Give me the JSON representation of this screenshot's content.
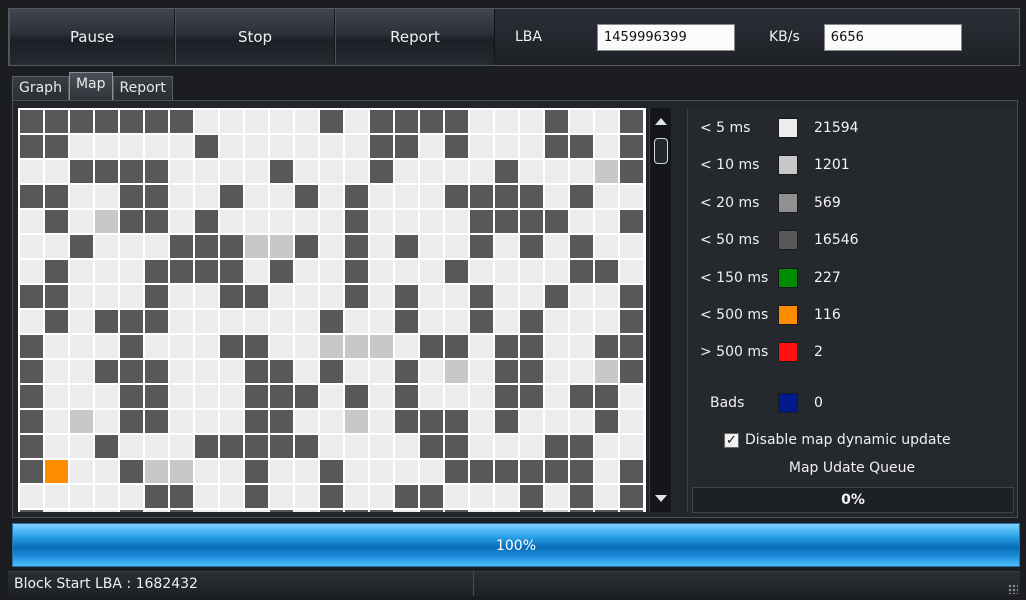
{
  "toolbar": {
    "pause_label": "Pause",
    "stop_label": "Stop",
    "report_label": "Report",
    "lba_label": "LBA",
    "lba_value": "1459996399",
    "kbs_label": "KB/s",
    "kbs_value": "6656"
  },
  "tabs": [
    {
      "label": "Graph",
      "active": false
    },
    {
      "label": "Map",
      "active": true
    },
    {
      "label": "Report",
      "active": false
    }
  ],
  "legend": {
    "items": [
      {
        "label": "< 5 ms",
        "color": "#ececec",
        "count": "21594"
      },
      {
        "label": "< 10 ms",
        "color": "#c8c8c8",
        "count": "1201"
      },
      {
        "label": "< 20 ms",
        "color": "#909090",
        "count": "569"
      },
      {
        "label": "< 50 ms",
        "color": "#585858",
        "count": "16546"
      },
      {
        "label": "< 150 ms",
        "color": "#008c00",
        "count": "227"
      },
      {
        "label": "< 500 ms",
        "color": "#ff8c00",
        "count": "116"
      },
      {
        "label": "> 500 ms",
        "color": "#ff1010",
        "count": "2"
      }
    ],
    "bads": {
      "label": "Bads",
      "color": "#001a8c",
      "count": "0"
    },
    "disable_update_label": "Disable map dynamic update",
    "disable_update_checked": true,
    "queue_label": "Map Udate Queue",
    "queue_percent": "0%"
  },
  "progress": {
    "label": "100%",
    "value": 1.0
  },
  "status": {
    "block_start": "Block Start LBA : 1682432"
  },
  "map_rows": [
    "3333333000003033330003003",
    "3300000300000033030003303",
    "0033330000300030000300013",
    "3300330030030300033330300",
    "0301330300000300003333003",
    "0030003331130303003030300",
    "0300033330300300030000330",
    "3300030033000303003003003",
    "0303330000003003003030003",
    "3000300033001110330330033",
    "3003330003303003010330013",
    "3000330003330303000330330",
    "3010330003300103330300030",
    "3003000333330000330003300",
    "3500311003003000033333303",
    "0000033003003003300030303",
    "3000303000303330330031333"
  ]
}
